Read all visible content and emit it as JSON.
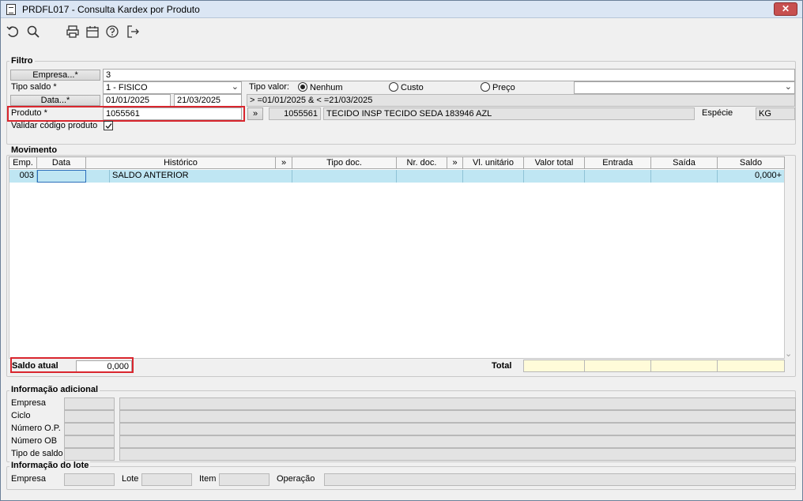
{
  "window": {
    "title": "PRDFL017 - Consulta Kardex por Produto",
    "close": "✕"
  },
  "toolbar": [
    "undo-icon",
    "search-icon",
    "print-icon",
    "calendar-icon",
    "help-icon",
    "exit-icon"
  ],
  "filtro": {
    "legend": "Filtro",
    "empresa_btn": "Empresa...*",
    "empresa_value": "3",
    "tipo_saldo_label": "Tipo saldo *",
    "tipo_saldo_value": "1 - FISICO",
    "tipo_valor_label": "Tipo valor:",
    "tipo_valor_options": [
      "Nenhum",
      "Custo",
      "Preço"
    ],
    "tipo_valor_selected": "Nenhum",
    "data_btn": "Data...*",
    "data_from": "01/01/2025",
    "data_to": "21/03/2025",
    "data_expr": "> =01/01/2025 & < =21/03/2025",
    "produto_label": "Produto *",
    "produto_value": "1055561",
    "produto_btn": "»",
    "produto_code": "1055561",
    "produto_desc": "TECIDO INSP TECIDO SEDA 183946 AZL",
    "especie_label": "Espécie",
    "especie_value": "KG",
    "validar_label": "Validar código produto",
    "validar_checked": true
  },
  "movimento": {
    "legend": "Movimento",
    "columns": [
      "Emp.",
      "Data",
      "Histórico",
      "»",
      "Tipo doc.",
      "Nr. doc.",
      "»",
      "Vl. unitário",
      "Valor total",
      "Entrada",
      "Saída",
      "Saldo"
    ],
    "rows": [
      {
        "emp": "003",
        "data": "",
        "historico": "SALDO ANTERIOR",
        "tipo_doc": "",
        "nr_doc": "",
        "vl_unit": "",
        "valor_total": "",
        "entrada": "",
        "saida": "",
        "saldo": "0,000+"
      }
    ],
    "saldo_atual_label": "Saldo atual",
    "saldo_atual_value": "0,000",
    "total_label": "Total"
  },
  "info_adicional": {
    "legend": "Informação adicional",
    "fields": [
      "Empresa",
      "Ciclo",
      "Número O.P.",
      "Número OB",
      "Tipo de saldo"
    ]
  },
  "info_lote": {
    "legend": "Informação do lote",
    "fields": [
      "Empresa",
      "Lote",
      "Item",
      "Operação"
    ]
  },
  "colors": {
    "accent_red": "#d9262e",
    "row_blue": "#bfe6f3",
    "total_yellow": "#fffbd9"
  }
}
